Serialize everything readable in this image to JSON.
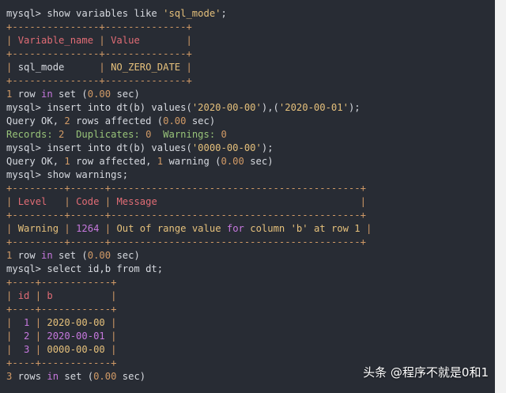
{
  "terminal": {
    "lines": [
      [
        {
          "t": "mysql> show variables like ",
          "c": "def"
        },
        {
          "t": "'sql_mode'",
          "c": "str"
        },
        {
          "t": ";",
          "c": "def"
        }
      ],
      [
        {
          "t": "+---------------+--------------+",
          "c": "tbl"
        }
      ],
      [
        {
          "t": "| ",
          "c": "tbl"
        },
        {
          "t": "Variable_name",
          "c": "hd"
        },
        {
          "t": " | ",
          "c": "tbl"
        },
        {
          "t": "Value",
          "c": "hd"
        },
        {
          "t": "        |",
          "c": "tbl"
        }
      ],
      [
        {
          "t": "+---------------+--------------+",
          "c": "tbl"
        }
      ],
      [
        {
          "t": "| ",
          "c": "tbl"
        },
        {
          "t": "sql_mode",
          "c": "def"
        },
        {
          "t": "      | ",
          "c": "tbl"
        },
        {
          "t": "NO_ZERO_DATE",
          "c": "str"
        },
        {
          "t": " |",
          "c": "tbl"
        }
      ],
      [
        {
          "t": "+---------------+--------------+",
          "c": "tbl"
        }
      ],
      [
        {
          "t": "1",
          "c": "num"
        },
        {
          "t": " row ",
          "c": "def"
        },
        {
          "t": "in",
          "c": "kw"
        },
        {
          "t": " set (",
          "c": "def"
        },
        {
          "t": "0.00",
          "c": "num"
        },
        {
          "t": " sec)",
          "c": "def"
        }
      ],
      [
        {
          "t": "mysql> insert into dt(b) values(",
          "c": "def"
        },
        {
          "t": "'2020-00-00'",
          "c": "str"
        },
        {
          "t": "),(",
          "c": "def"
        },
        {
          "t": "'2020-00-01'",
          "c": "str"
        },
        {
          "t": ");",
          "c": "def"
        }
      ],
      [
        {
          "t": "Query OK, ",
          "c": "def"
        },
        {
          "t": "2",
          "c": "num"
        },
        {
          "t": " rows affected (",
          "c": "def"
        },
        {
          "t": "0.00",
          "c": "num"
        },
        {
          "t": " sec)",
          "c": "def"
        }
      ],
      [
        {
          "t": "Records: ",
          "c": "grn"
        },
        {
          "t": "2",
          "c": "num"
        },
        {
          "t": "  Duplicates: ",
          "c": "grn"
        },
        {
          "t": "0",
          "c": "num"
        },
        {
          "t": "  Warnings: ",
          "c": "grn"
        },
        {
          "t": "0",
          "c": "num"
        }
      ],
      [
        {
          "t": "mysql> insert into dt(b) values(",
          "c": "def"
        },
        {
          "t": "'0000-00-00'",
          "c": "str"
        },
        {
          "t": ");",
          "c": "def"
        }
      ],
      [
        {
          "t": "Query OK, ",
          "c": "def"
        },
        {
          "t": "1",
          "c": "num"
        },
        {
          "t": " row affected, ",
          "c": "def"
        },
        {
          "t": "1",
          "c": "num"
        },
        {
          "t": " warning (",
          "c": "def"
        },
        {
          "t": "0.00",
          "c": "num"
        },
        {
          "t": " sec)",
          "c": "def"
        }
      ],
      [
        {
          "t": "mysql> show warnings;",
          "c": "def"
        }
      ],
      [
        {
          "t": "+---------+------+-------------------------------------------+",
          "c": "tbl"
        }
      ],
      [
        {
          "t": "| ",
          "c": "tbl"
        },
        {
          "t": "Level",
          "c": "hd"
        },
        {
          "t": "   | ",
          "c": "tbl"
        },
        {
          "t": "Code",
          "c": "hd"
        },
        {
          "t": " | ",
          "c": "tbl"
        },
        {
          "t": "Message",
          "c": "hd"
        },
        {
          "t": "                                   |",
          "c": "tbl"
        }
      ],
      [
        {
          "t": "+---------+------+-------------------------------------------+",
          "c": "tbl"
        }
      ],
      [
        {
          "t": "| ",
          "c": "tbl"
        },
        {
          "t": "Warning",
          "c": "str"
        },
        {
          "t": " | ",
          "c": "tbl"
        },
        {
          "t": "1264",
          "c": "pur"
        },
        {
          "t": " | ",
          "c": "tbl"
        },
        {
          "t": "Out of range value ",
          "c": "str"
        },
        {
          "t": "for",
          "c": "kw"
        },
        {
          "t": " column 'b' at row 1",
          "c": "str"
        },
        {
          "t": " |",
          "c": "tbl"
        }
      ],
      [
        {
          "t": "+---------+------+-------------------------------------------+",
          "c": "tbl"
        }
      ],
      [
        {
          "t": "1",
          "c": "num"
        },
        {
          "t": " row ",
          "c": "def"
        },
        {
          "t": "in",
          "c": "kw"
        },
        {
          "t": " set (",
          "c": "def"
        },
        {
          "t": "0.00",
          "c": "num"
        },
        {
          "t": " sec)",
          "c": "def"
        }
      ],
      [
        {
          "t": "mysql> select id,b from dt;",
          "c": "def"
        }
      ],
      [
        {
          "t": "+----+------------+",
          "c": "tbl"
        }
      ],
      [
        {
          "t": "| ",
          "c": "tbl"
        },
        {
          "t": "id",
          "c": "hd"
        },
        {
          "t": " | ",
          "c": "tbl"
        },
        {
          "t": "b",
          "c": "hd"
        },
        {
          "t": "          |",
          "c": "tbl"
        }
      ],
      [
        {
          "t": "+----+------------+",
          "c": "tbl"
        }
      ],
      [
        {
          "t": "|  ",
          "c": "tbl"
        },
        {
          "t": "1",
          "c": "pur"
        },
        {
          "t": " | ",
          "c": "tbl"
        },
        {
          "t": "2020-00-00",
          "c": "str"
        },
        {
          "t": " |",
          "c": "tbl"
        }
      ],
      [
        {
          "t": "|  ",
          "c": "tbl"
        },
        {
          "t": "2",
          "c": "pur"
        },
        {
          "t": " | ",
          "c": "tbl"
        },
        {
          "t": "2020-00-01",
          "c": "pur"
        },
        {
          "t": " |",
          "c": "tbl"
        }
      ],
      [
        {
          "t": "|  ",
          "c": "tbl"
        },
        {
          "t": "3",
          "c": "pur"
        },
        {
          "t": " | ",
          "c": "tbl"
        },
        {
          "t": "0000-00-00",
          "c": "str"
        },
        {
          "t": " |",
          "c": "tbl"
        }
      ],
      [
        {
          "t": "+----+------------+",
          "c": "tbl"
        }
      ],
      [
        {
          "t": "3",
          "c": "num"
        },
        {
          "t": " rows ",
          "c": "def"
        },
        {
          "t": "in",
          "c": "kw"
        },
        {
          "t": " set (",
          "c": "def"
        },
        {
          "t": "0.00",
          "c": "num"
        },
        {
          "t": " sec)",
          "c": "def"
        }
      ]
    ]
  },
  "watermark": "头条 @程序不就是0和1",
  "colors": {
    "background": "#282c34",
    "default": "#d7dae0",
    "keyword": "#c678dd",
    "string": "#e5c07b",
    "number": "#d19a66",
    "header": "#e06c75",
    "green": "#98c379",
    "table_border": "#d19a66"
  }
}
